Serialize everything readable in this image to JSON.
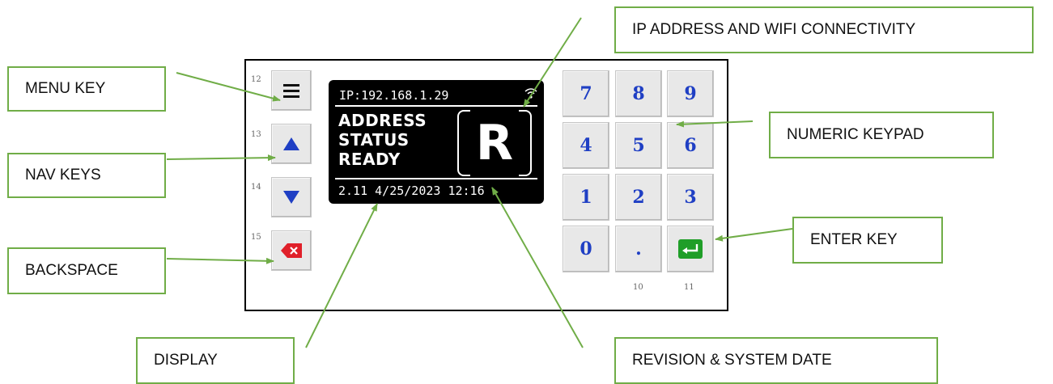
{
  "callouts": {
    "ip_wifi": "IP ADDRESS AND WIFI CONNECTIVITY",
    "menu": "MENU KEY",
    "nav": "NAV KEYS",
    "numeric": "NUMERIC KEYPAD",
    "enter": "ENTER KEY",
    "backspace": "BACKSPACE",
    "display": "DISPLAY",
    "revision": "REVISION & SYSTEM DATE"
  },
  "side_key_numbers": [
    "12",
    "13",
    "14",
    "15"
  ],
  "bottom_key_numbers": [
    "10",
    "11"
  ],
  "icons": {
    "menu": "hamburger-icon",
    "up": "up-triangle-icon",
    "down": "down-triangle-icon",
    "backspace": "backspace-icon",
    "enter": "enter-icon",
    "wifi": "wifi-icon"
  },
  "keypad": {
    "k7": "7",
    "k8": "8",
    "k9": "9",
    "k4": "4",
    "k5": "5",
    "k6": "6",
    "k1": "1",
    "k2": "2",
    "k3": "3",
    "k0": "0",
    "dot": "."
  },
  "display": {
    "ip": "IP:192.168.1.29",
    "line1": "ADDRESS",
    "line2": "STATUS",
    "line3": "READY",
    "big_letter": "R",
    "footer": "2.11  4/25/2023 12:16"
  },
  "colors": {
    "callout_border": "#70ad47",
    "key_digit": "#1f3fc4",
    "nav_arrow": "#1f3fc4",
    "backspace": "#e0202a",
    "enter": "#1f9e28"
  }
}
